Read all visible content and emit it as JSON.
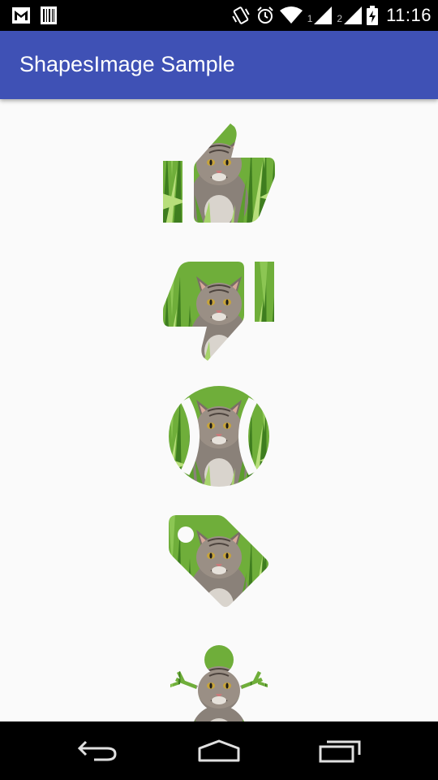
{
  "status_bar": {
    "left_icons": [
      "gmail-icon",
      "barcode-icon"
    ],
    "right_icons": [
      "vibrate-icon",
      "alarm-icon",
      "wifi-icon",
      "signal-sim1-icon",
      "signal-sim2-icon",
      "battery-charging-icon"
    ],
    "sim1_label": "1",
    "sim2_label": "2",
    "time": "11:16"
  },
  "app_bar": {
    "title": "ShapesImage Sample",
    "color": "#3f51b5"
  },
  "shapes": [
    {
      "name": "thumbs-up",
      "image": "cat-in-grass"
    },
    {
      "name": "thumbs-down",
      "image": "cat-in-grass"
    },
    {
      "name": "tennis-ball",
      "image": "cat-in-grass"
    },
    {
      "name": "tag",
      "image": "cat-in-grass"
    },
    {
      "name": "snowman",
      "image": "cat-in-grass"
    }
  ],
  "nav_bar": {
    "buttons": [
      "back-icon",
      "home-icon",
      "recents-icon"
    ]
  }
}
